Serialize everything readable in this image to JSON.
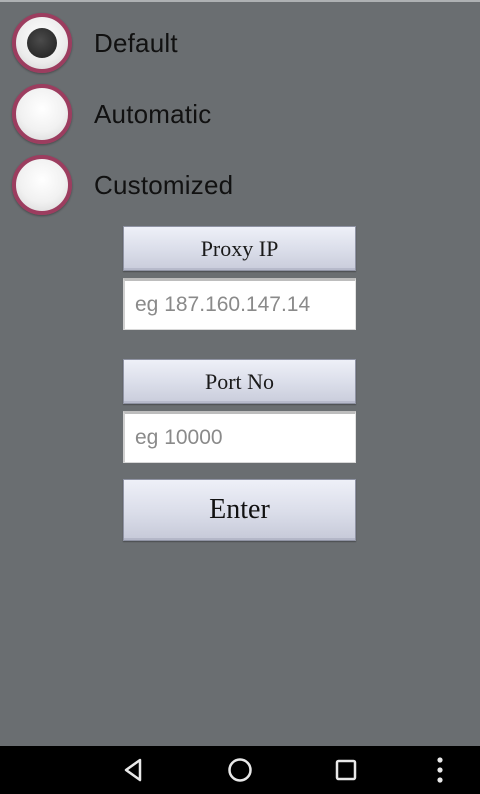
{
  "proxy_options": [
    {
      "label": "Default",
      "checked": true
    },
    {
      "label": "Automatic",
      "checked": false
    },
    {
      "label": "Customized",
      "checked": false
    }
  ],
  "proxy_ip": {
    "label": "Proxy IP",
    "value": "",
    "placeholder": "eg 187.160.147.14"
  },
  "port": {
    "label": "Port No",
    "value": "",
    "placeholder": "eg 10000"
  },
  "enter_label": "Enter",
  "navigation": {
    "icons": [
      "back-icon",
      "home-icon",
      "recent-apps-icon",
      "overflow-menu-icon"
    ]
  },
  "colors": {
    "background": "#6a6e71",
    "radio_border": "#9c3d5f",
    "navbar": "#000000"
  }
}
